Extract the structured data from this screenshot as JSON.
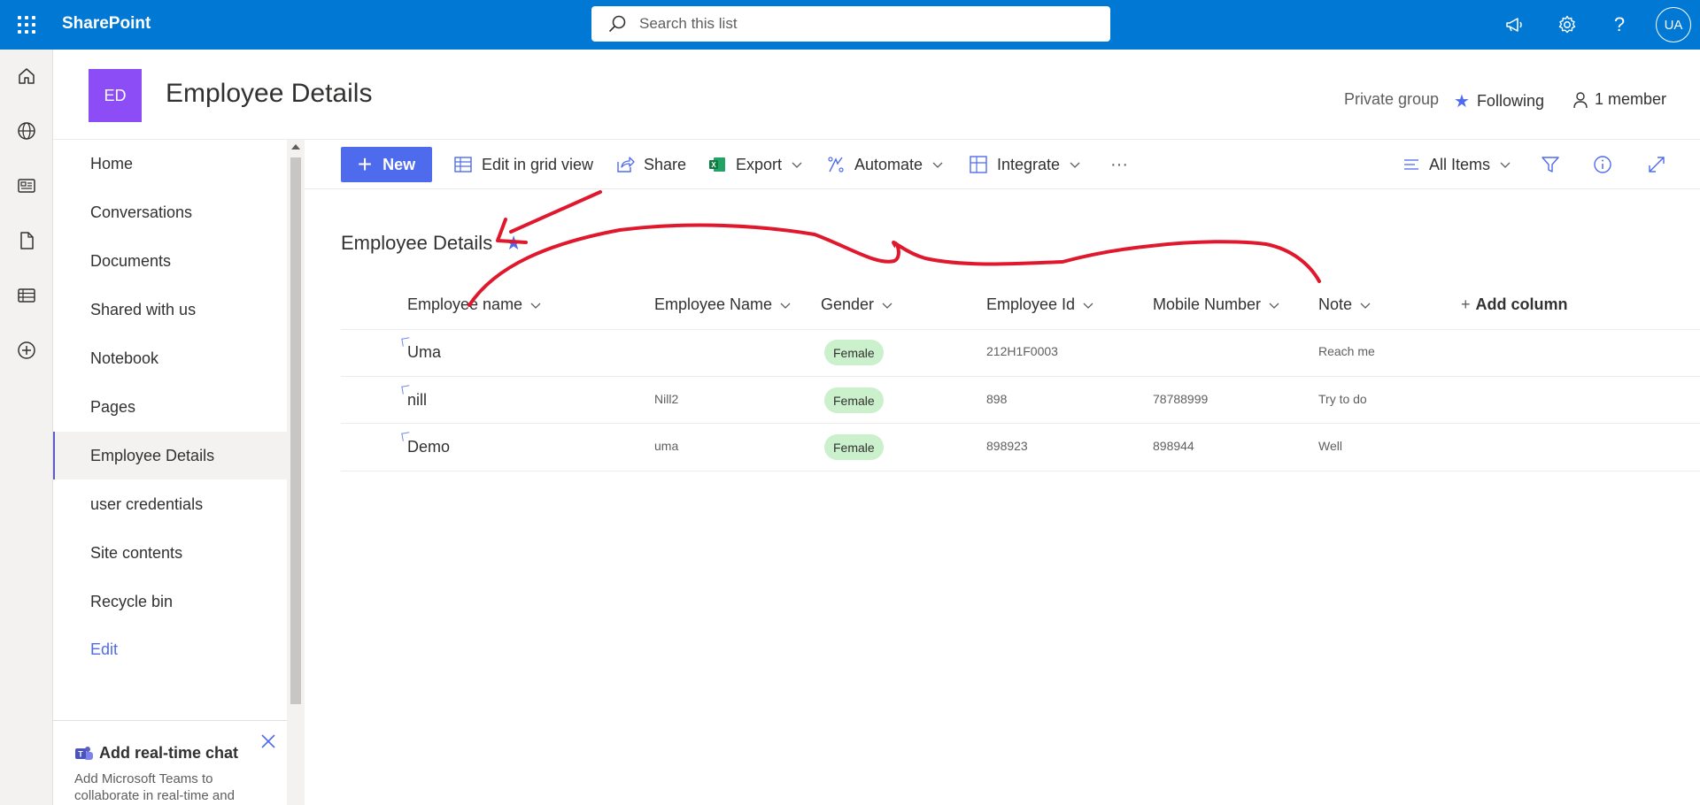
{
  "suitebar": {
    "brand": "SharePoint",
    "search_placeholder": "Search this list",
    "avatar_initials": "UA",
    "icons": [
      "waffle-icon",
      "megaphone-icon",
      "gear-icon",
      "help-icon"
    ],
    "color": "#0078d4"
  },
  "site": {
    "logo_initials": "ED",
    "logo_color": "#8c4cf6",
    "title": "Employee Details",
    "privacy": "Private group",
    "following": "Following",
    "members": "1 member"
  },
  "nav": {
    "items": [
      {
        "label": "Home"
      },
      {
        "label": "Conversations"
      },
      {
        "label": "Documents"
      },
      {
        "label": "Shared with us"
      },
      {
        "label": "Notebook"
      },
      {
        "label": "Pages"
      },
      {
        "label": "Employee Details"
      },
      {
        "label": "user credentials"
      },
      {
        "label": "Site contents"
      },
      {
        "label": "Recycle bin"
      },
      {
        "label": "Edit"
      }
    ],
    "active_index": 6,
    "chat": {
      "title": "Add real-time chat",
      "description": "Add Microsoft Teams to collaborate in real-time and"
    }
  },
  "commands": {
    "new": "New",
    "edit_grid": "Edit in grid view",
    "share": "Share",
    "export": "Export",
    "automate": "Automate",
    "integrate": "Integrate",
    "more": "···",
    "view": "All Items"
  },
  "list": {
    "title": "Employee Details",
    "columns": [
      "Employee name",
      "Employee Name",
      "Gender",
      "Employee Id",
      "Mobile Number",
      "Note"
    ],
    "add_column": "Add column",
    "rows": [
      {
        "title": "Uma",
        "employee_name": "",
        "gender": "Female",
        "employee_id": "212H1F0003",
        "mobile": "",
        "note": "Reach me"
      },
      {
        "title": "nill",
        "employee_name": "Nill2",
        "gender": "Female",
        "employee_id": "898",
        "mobile": "78788999",
        "note": "Try to do"
      },
      {
        "title": "Demo",
        "employee_name": "uma",
        "gender": "Female",
        "employee_id": "898923",
        "mobile": "898944",
        "note": "Well"
      }
    ]
  },
  "annotation_color": "#e0182d"
}
